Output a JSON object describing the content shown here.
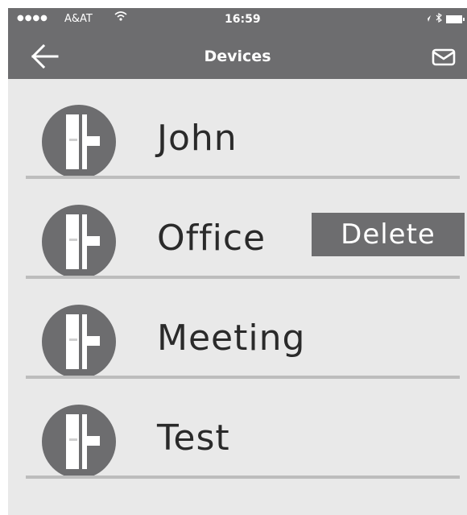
{
  "status_bar": {
    "signal": "●●●●",
    "carrier": "A&AT",
    "time": "16:59"
  },
  "header": {
    "title": "Devices"
  },
  "devices": [
    {
      "name": "John"
    },
    {
      "name": "Office"
    },
    {
      "name": "Meeting"
    },
    {
      "name": "Test"
    }
  ],
  "actions": {
    "delete_label": "Delete"
  },
  "icons": {
    "back": "arrow-left-icon",
    "mail": "envelope-icon",
    "device": "lock-icon"
  },
  "colors": {
    "header_bg": "#6d6d6f",
    "page_bg": "#e9e9e9",
    "icon_bg": "#6d6d6f",
    "divider": "#bdbdbd",
    "text": "#2a2a2a"
  }
}
